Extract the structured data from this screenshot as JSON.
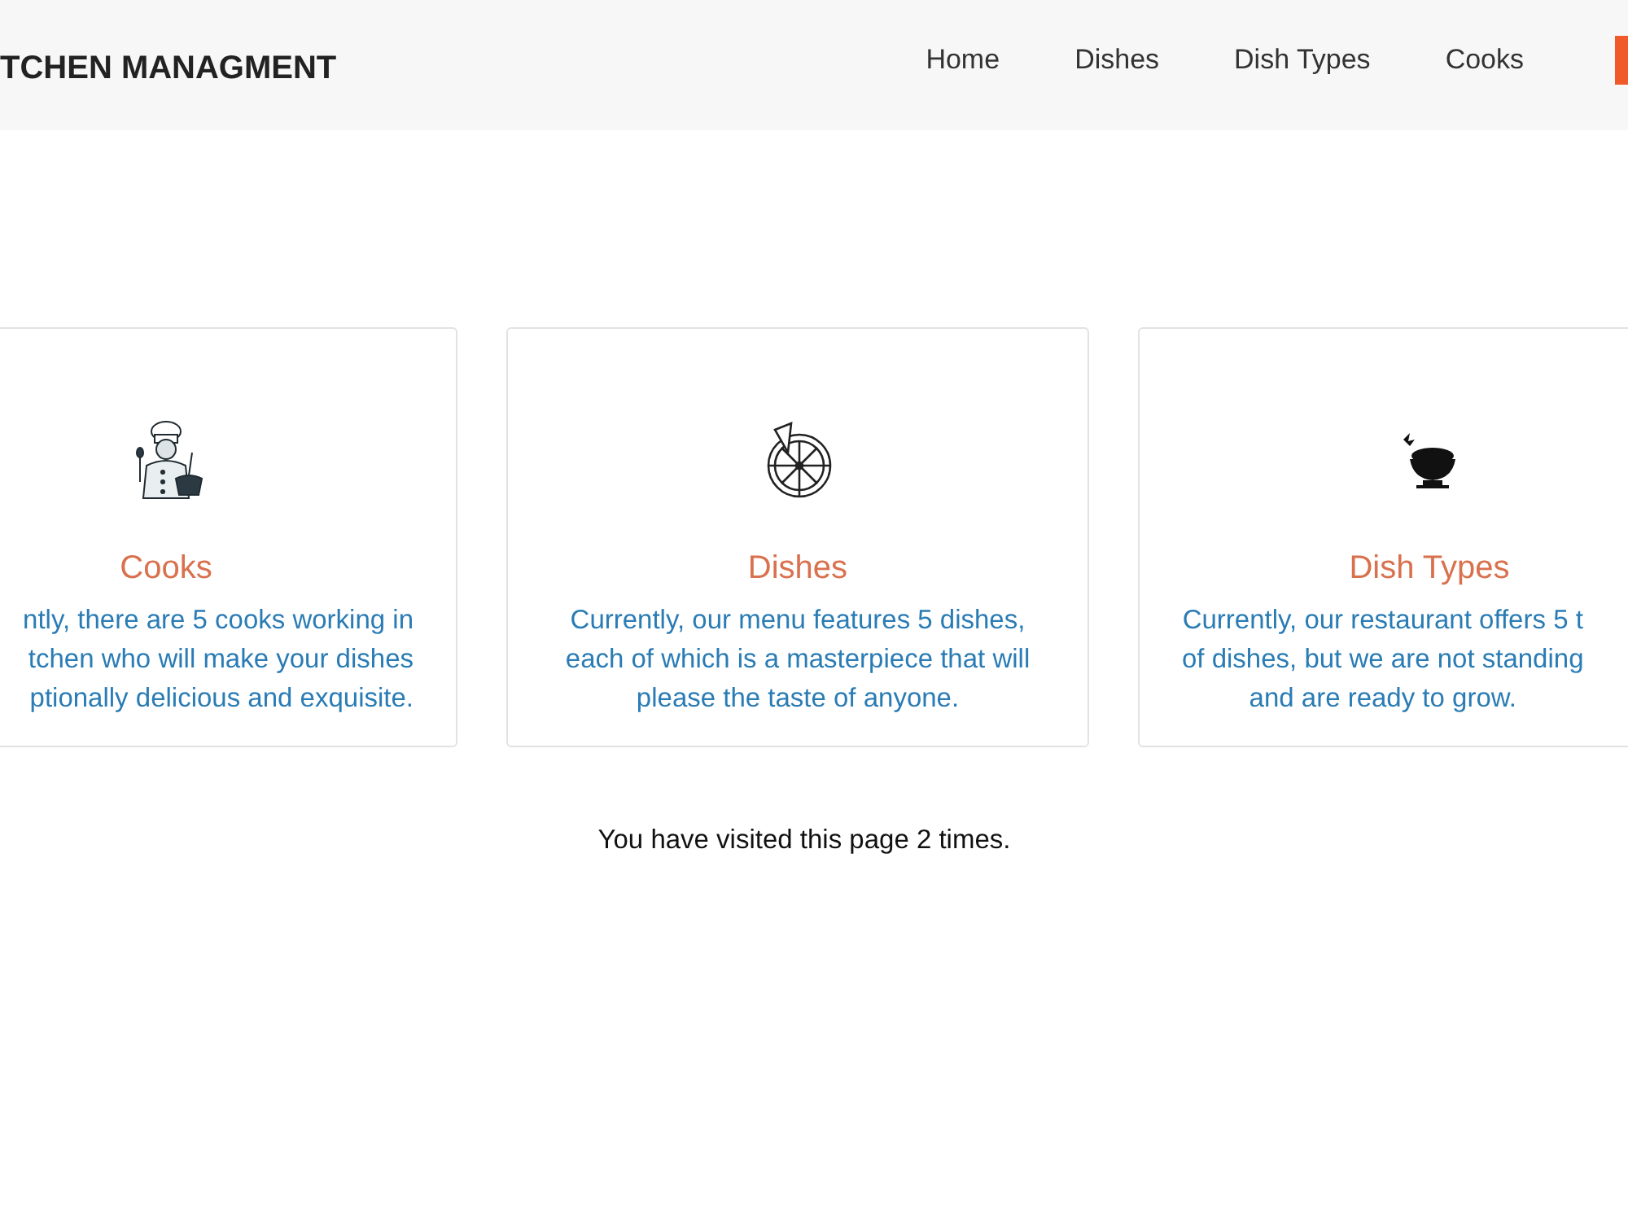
{
  "header": {
    "brand": "TCHEN MANAGMENT",
    "nav": [
      {
        "label": "Home"
      },
      {
        "label": "Dishes"
      },
      {
        "label": "Dish Types"
      },
      {
        "label": "Cooks"
      }
    ]
  },
  "cards": [
    {
      "title": "Cooks",
      "lines": [
        "ntly, there are 5 cooks working in",
        "tchen who will make your dishes",
        "ptionally delicious and exquisite."
      ]
    },
    {
      "title": "Dishes",
      "lines": [
        "Currently, our menu features 5 dishes,",
        "each of which is a masterpiece that will",
        "please the taste of anyone."
      ]
    },
    {
      "title": "Dish Types",
      "lines": [
        "Currently, our restaurant offers 5 t",
        "of dishes, but we are not standing",
        "and are ready to grow."
      ]
    }
  ],
  "visits": "You have visited this page 2 times."
}
